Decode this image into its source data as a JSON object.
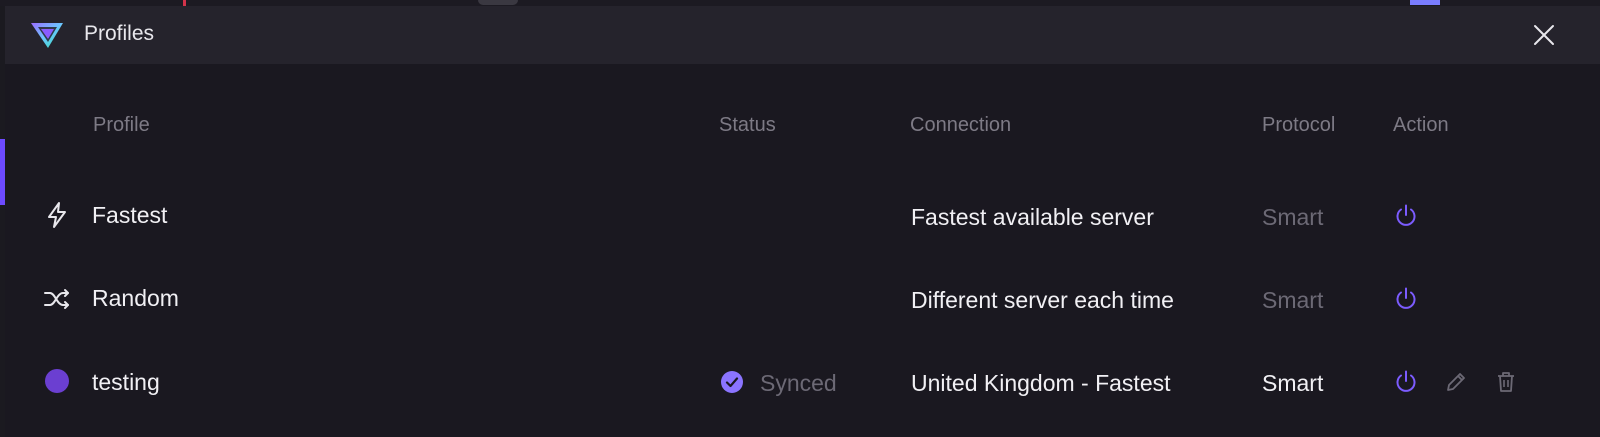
{
  "window": {
    "title": "Profiles"
  },
  "icons": {
    "logo": "proton-vpn-logo",
    "close": "close-icon",
    "power": "power-icon",
    "edit": "edit-icon",
    "delete": "trash-icon",
    "fastest": "bolt-icon",
    "random": "shuffle-icon",
    "status_ok": "check-circle-icon"
  },
  "colors": {
    "accent": "#7c5cff",
    "profile_dot": "#6b3fd1",
    "text": "#f1f0f4",
    "muted": "#6c6975"
  },
  "table": {
    "headers": {
      "profile": "Profile",
      "status": "Status",
      "connection": "Connection",
      "protocol": "Protocol",
      "action": "Action"
    },
    "rows": [
      {
        "profile": "Fastest",
        "status": "",
        "connection": "Fastest available server",
        "protocol": "Smart"
      },
      {
        "profile": "Random",
        "status": "",
        "connection": "Different server each time",
        "protocol": "Smart"
      },
      {
        "profile": "testing",
        "status": "Synced",
        "connection": "United Kingdom - Fastest",
        "protocol": "Smart"
      }
    ]
  }
}
